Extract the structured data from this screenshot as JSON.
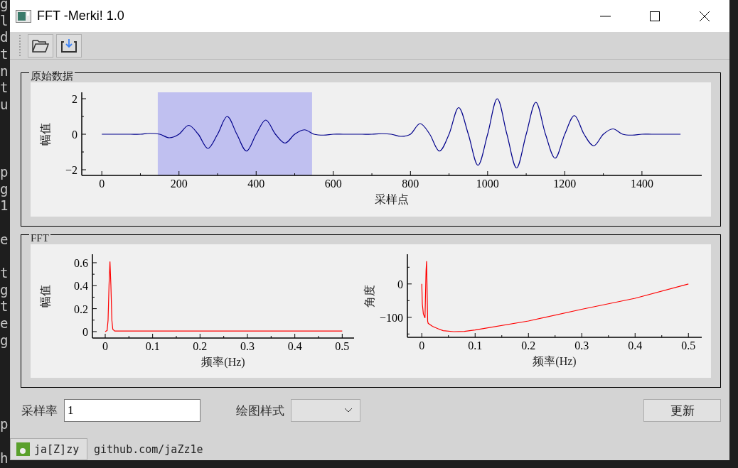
{
  "desktop": {
    "editor_letters": [
      [
        "g",
        "l",
        "d",
        "t",
        "n",
        "t",
        "u"
      ],
      [
        "p",
        "g",
        "1"
      ],
      [
        "e"
      ],
      [
        "t",
        "g",
        "t",
        "e",
        "g"
      ],
      [
        "p"
      ],
      [
        "h"
      ]
    ]
  },
  "window": {
    "title": "FFT -Merki! 1.0"
  },
  "toolbar": {
    "buttons": [
      {
        "kind": "open"
      },
      {
        "kind": "download"
      }
    ]
  },
  "raw_group": {
    "title": "原始数据",
    "chart_data": {
      "type": "line",
      "xlabel": "采样点",
      "ylabel": "幅值",
      "x": [
        0,
        25,
        50,
        75,
        100,
        125,
        150,
        175,
        200,
        225,
        250,
        275,
        300,
        325,
        350,
        375,
        400,
        425,
        450,
        475,
        500,
        525,
        550,
        575,
        600,
        625,
        650,
        675,
        700,
        725,
        750,
        775,
        800,
        825,
        850,
        875,
        900,
        925,
        950,
        975,
        1000,
        1025,
        1050,
        1075,
        1100,
        1125,
        1150,
        1175,
        1200,
        1225,
        1250,
        1275,
        1300,
        1325,
        1350,
        1375,
        1400,
        1425,
        1450,
        1475,
        1500
      ],
      "series": [
        {
          "color": "#00008b",
          "values": [
            0,
            0,
            0,
            0,
            0,
            0.05,
            0,
            -0.2,
            0,
            0.5,
            0,
            -0.8,
            0,
            1.0,
            0,
            -0.95,
            0,
            0.8,
            0,
            -0.5,
            0,
            0.25,
            0,
            -0.05,
            0,
            0,
            0,
            0,
            0,
            0.03,
            0,
            -0.12,
            0,
            0.6,
            0,
            -0.95,
            0,
            1.5,
            0,
            -1.75,
            0,
            2.0,
            0,
            -1.9,
            0,
            1.8,
            0,
            -1.35,
            0,
            1.05,
            0,
            -0.65,
            0,
            0.3,
            0,
            -0.05,
            0,
            0,
            0,
            0,
            0
          ]
        }
      ],
      "xlim": [
        -52,
        1555
      ],
      "ylim": [
        -2.32,
        2.36
      ],
      "xticks": [
        0,
        200,
        400,
        600,
        800,
        1000,
        1200,
        1400
      ],
      "yticks": [
        -2,
        0,
        2
      ],
      "bands": [
        {
          "axis": "x",
          "from": 145,
          "to": 545,
          "color": "#c0c0f0"
        }
      ]
    }
  },
  "fft_group": {
    "title": "FFT",
    "charts": [
      {
        "chart_data": {
          "type": "line",
          "xlabel": "频率(Hz)",
          "ylabel": "幅值",
          "x": [
            0,
            0.004,
            0.006,
            0.008,
            0.01,
            0.012,
            0.014,
            0.016,
            0.02,
            0.1,
            0.2,
            0.3,
            0.4,
            0.5
          ],
          "series": [
            {
              "color": "#ff0000",
              "values": [
                0,
                0.01,
                0.1,
                0.4,
                0.61,
                0.4,
                0.1,
                0.02,
                0.005,
                0.005,
                0.005,
                0.005,
                0.005,
                0.005
              ]
            }
          ],
          "xlim": [
            -0.027,
            0.525
          ],
          "ylim": [
            -0.056,
            0.674
          ],
          "xticks": [
            0,
            0.1,
            0.2,
            0.3,
            0.4,
            0.5
          ],
          "yticks": [
            0,
            0.2,
            0.4,
            0.6
          ]
        }
      },
      {
        "chart_data": {
          "type": "line",
          "xlabel": "频率(Hz)",
          "ylabel": "角度",
          "x": [
            0,
            0.001,
            0.003,
            0.006,
            0.007,
            0.008,
            0.009,
            0.01,
            0.011,
            0.012,
            0.02,
            0.03,
            0.04,
            0.06,
            0.08,
            0.1,
            0.2,
            0.3,
            0.4,
            0.5
          ],
          "series": [
            {
              "color": "#ff0000",
              "values": [
                0,
                -60,
                -90,
                -102,
                -30,
                40,
                68,
                -20,
                -112,
                -118,
                -127,
                -134,
                -140,
                -143,
                -142,
                -138,
                -111,
                -76,
                -43,
                0
              ]
            }
          ],
          "xlim": [
            -0.027,
            0.525
          ],
          "ylim": [
            -160,
            89
          ],
          "xticks": [
            0,
            0.1,
            0.2,
            0.3,
            0.4,
            0.5
          ],
          "yticks": [
            -100,
            0
          ]
        }
      }
    ]
  },
  "controls": {
    "sample_rate_label": "采样率",
    "sample_rate_value": "1",
    "plot_style_label": "绘图样式",
    "update_button": "更新"
  },
  "status_bar": {
    "author_button": "ja[Z]zy",
    "link": "github.com/jaZz1e"
  }
}
